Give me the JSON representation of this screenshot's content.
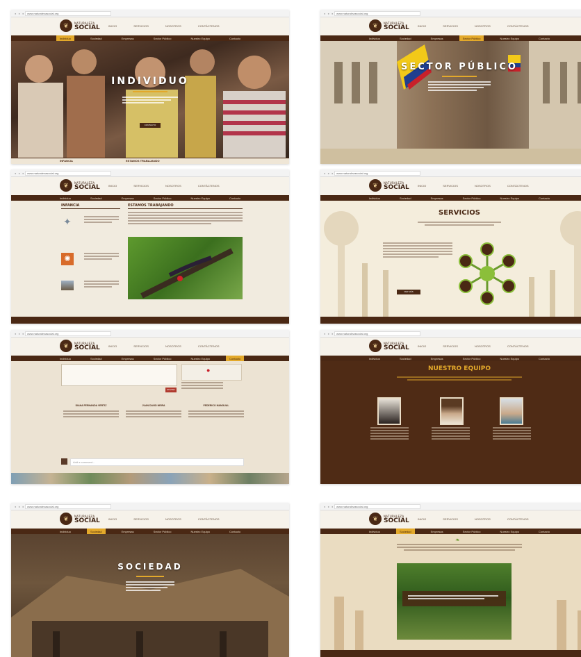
{
  "brand": {
    "line1": "NATURALEZA",
    "line2": "SOCIAL",
    "mark_icon": "leaf-emblem-icon"
  },
  "browser": {
    "url": "www.naturalezasocial.org",
    "controls": "● ● ●"
  },
  "top_links": [
    "INICIO",
    "SERVICIOS",
    "NOSOTROS",
    "CONTÁCTENOS"
  ],
  "nav": [
    "Individuo",
    "Sociedad",
    "Empresas",
    "Sector Público",
    "Nuestro Equipo",
    "Contacto"
  ],
  "colors": {
    "brown": "#4a2814",
    "gold": "#e3a92b",
    "cream": "#efe6d6",
    "green": "#6a9a2c"
  },
  "shots": {
    "individuo": {
      "title": "INDIVIDUO",
      "button": "CONTACTO",
      "tab1": "INFANCIA",
      "tab2": "ESTAMOS TRABAJANDO"
    },
    "sector_publico": {
      "title": "SECTOR PÚBLICO"
    },
    "detalle": {
      "col1": "INFANCIA",
      "col2": "ESTAMOS TRABAJANDO"
    },
    "servicios": {
      "title": "SERVICIOS",
      "button": "VER MÁS"
    },
    "contacto": {
      "send": "ENVIAR",
      "people": [
        "DIANA FERNANDA VERTIZ",
        "JUAN DAVID NEIRA",
        "FEDERICO MANGUAL"
      ],
      "comment_placeholder": "Add a comment..."
    },
    "equipo": {
      "title": "NUESTRO EQUIPO"
    },
    "sociedad": {
      "title": "SOCIEDAD"
    },
    "empresas": {}
  }
}
